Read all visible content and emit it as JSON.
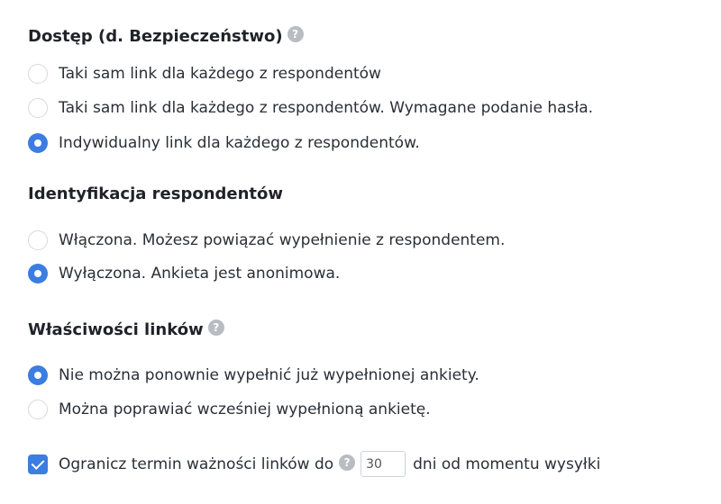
{
  "access": {
    "title": "Dostęp (d. Bezpieczeństwo)",
    "help": "?",
    "options": [
      {
        "label": "Taki sam link dla każdego z respondentów",
        "checked": false
      },
      {
        "label": "Taki sam link dla każdego z respondentów. Wymagane podanie hasła.",
        "checked": false
      },
      {
        "label": "Indywidualny link dla każdego z respondentów.",
        "checked": true
      }
    ]
  },
  "identification": {
    "title": "Identyfikacja respondentów",
    "options": [
      {
        "label": "Włączona. Możesz powiązać wypełnienie z respondentem.",
        "checked": false
      },
      {
        "label": "Wyłączona. Ankieta jest anonimowa.",
        "checked": true
      }
    ]
  },
  "link_properties": {
    "title": "Właściwości linków",
    "help": "?",
    "options": [
      {
        "label": "Nie można ponownie wypełnić już wypełnionej ankiety.",
        "checked": true
      },
      {
        "label": "Można poprawiać wcześniej wypełnioną ankietę.",
        "checked": false
      }
    ]
  },
  "expiry": {
    "checked": true,
    "label": "Ogranicz termin ważności linków do",
    "help": "?",
    "days_value": "30",
    "suffix": "dni od momentu wysyłki"
  }
}
